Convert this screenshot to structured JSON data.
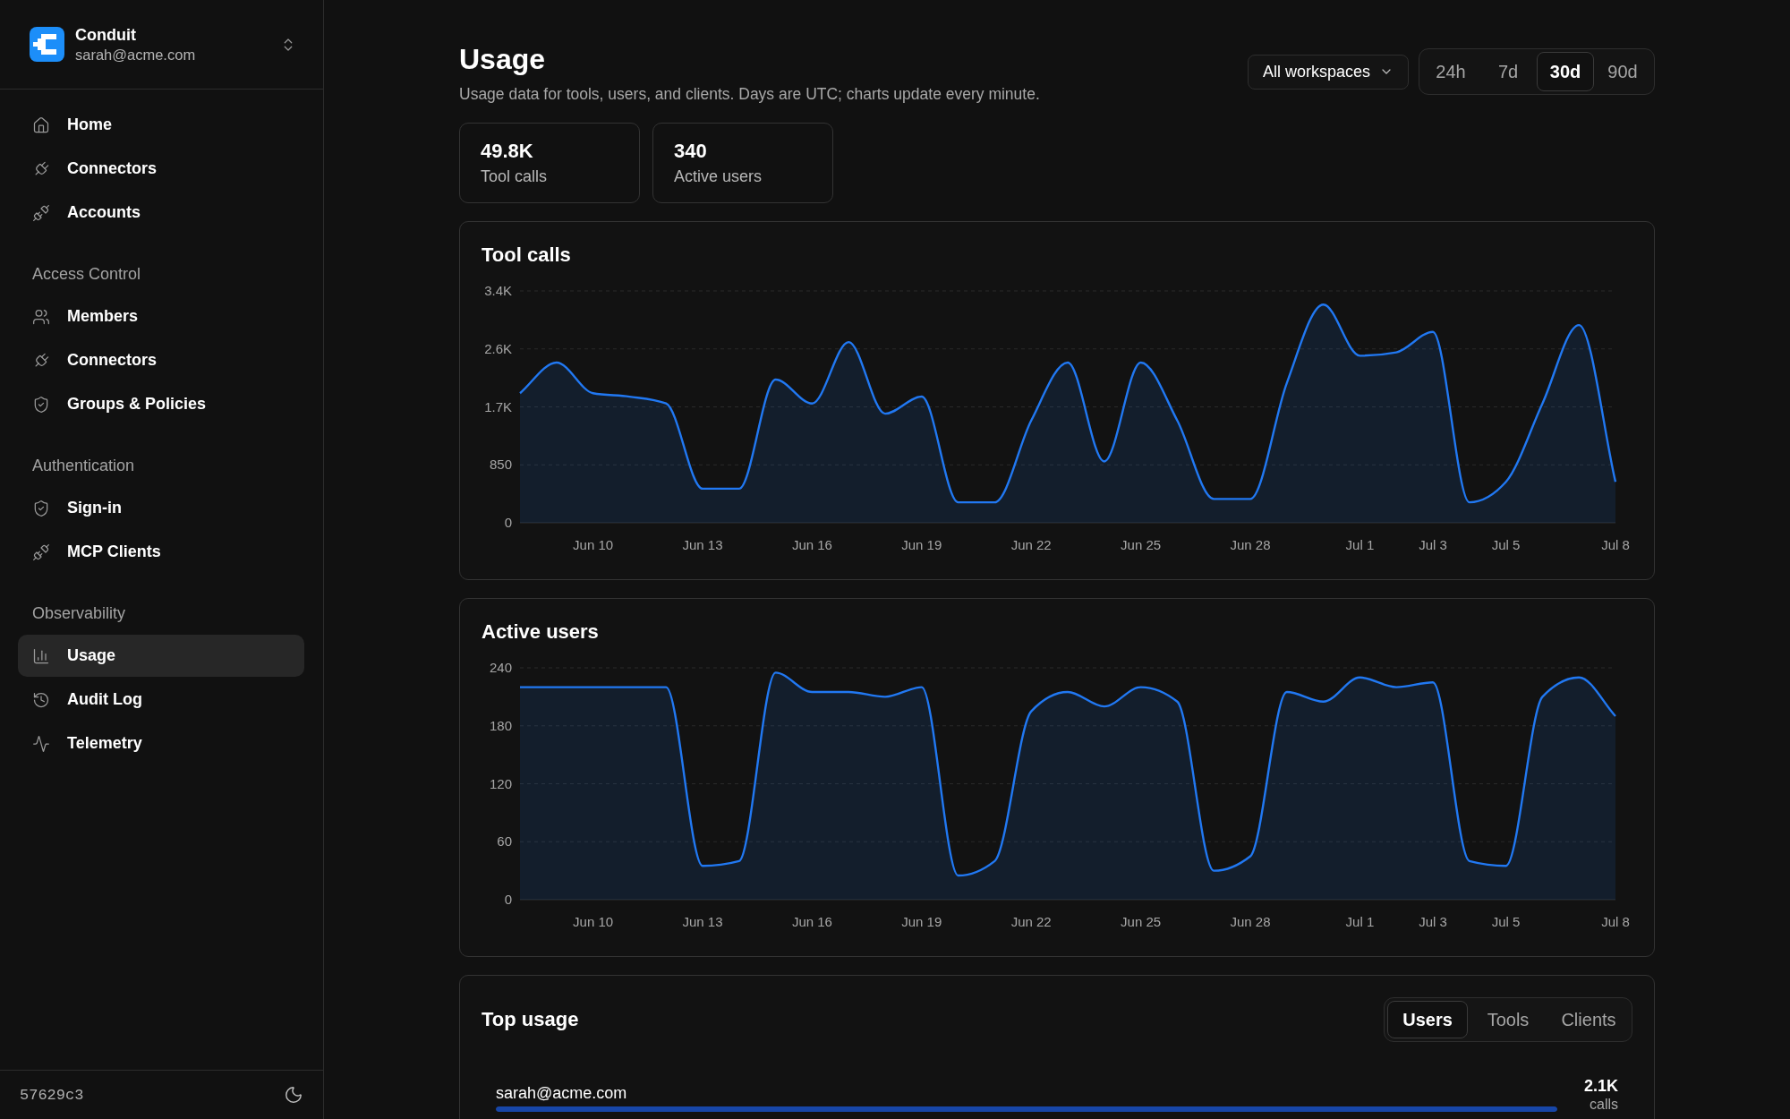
{
  "sidebar": {
    "brand": {
      "name": "Conduit",
      "email": "sarah@acme.com"
    },
    "sections": [
      {
        "items": [
          {
            "label": "Home",
            "selected": false
          },
          {
            "label": "Connectors",
            "selected": false
          },
          {
            "label": "Accounts",
            "selected": false
          }
        ]
      },
      {
        "title": "Access Control",
        "items": [
          {
            "label": "Members",
            "selected": false
          },
          {
            "label": "Connectors",
            "selected": false
          },
          {
            "label": "Groups & Policies",
            "selected": false
          }
        ]
      },
      {
        "title": "Authentication",
        "items": [
          {
            "label": "Sign-in",
            "selected": false
          },
          {
            "label": "MCP Clients",
            "selected": false
          }
        ]
      },
      {
        "title": "Observability",
        "items": [
          {
            "label": "Usage",
            "selected": true
          },
          {
            "label": "Audit Log",
            "selected": false
          },
          {
            "label": "Telemetry",
            "selected": false
          }
        ]
      }
    ],
    "footer": {
      "version": "57629c3"
    }
  },
  "header": {
    "title": "Usage",
    "subtitle": "Usage data for tools, users, and clients. Days are UTC; charts update every minute.",
    "workspace_select": {
      "value": "All workspaces"
    },
    "ranges": [
      {
        "label": "24h",
        "selected": false
      },
      {
        "label": "7d",
        "selected": false
      },
      {
        "label": "30d",
        "selected": true
      },
      {
        "label": "90d",
        "selected": false
      }
    ]
  },
  "stats": [
    {
      "value": "49.8K",
      "label": "Tool calls"
    },
    {
      "value": "340",
      "label": "Active users"
    }
  ],
  "charts": [
    {
      "chart_data": {
        "type": "area",
        "title": "Tool calls",
        "grid": true,
        "categories": [
          null,
          null,
          "Jun 10",
          null,
          null,
          "Jun 13",
          null,
          null,
          "Jun 16",
          null,
          null,
          "Jun 19",
          null,
          null,
          "Jun 22",
          null,
          null,
          "Jun 25",
          null,
          null,
          "Jun 28",
          null,
          null,
          "Jul 1",
          null,
          "Jul 3",
          null,
          "Jul 5",
          null,
          null,
          "Jul 8"
        ],
        "ylim": [
          0,
          3400
        ],
        "yticks": [
          0,
          850,
          {
            "value": 1700,
            "label": "1.7K"
          },
          {
            "value": 2550,
            "label": "2.6K"
          },
          {
            "value": 3400,
            "label": "3.4K"
          }
        ],
        "series": [
          {
            "color": "#2178f2",
            "values": [
              1900,
              2350,
              1900,
              1850,
              1750,
              500,
              500,
              2100,
              1750,
              2650,
              1600,
              1850,
              300,
              300,
              1500,
              2350,
              900,
              2350,
              1500,
              350,
              350,
              2050,
              3200,
              2450,
              2500,
              2800,
              300,
              600,
              1750,
              2900,
              600
            ]
          }
        ]
      }
    },
    {
      "chart_data": {
        "type": "area",
        "title": "Active users",
        "grid": true,
        "categories": [
          null,
          null,
          "Jun 10",
          null,
          null,
          "Jun 13",
          null,
          null,
          "Jun 16",
          null,
          null,
          "Jun 19",
          null,
          null,
          "Jun 22",
          null,
          null,
          "Jun 25",
          null,
          null,
          "Jun 28",
          null,
          null,
          "Jul 1",
          null,
          "Jul 3",
          null,
          "Jul 5",
          null,
          null,
          "Jul 8"
        ],
        "ylim": [
          0,
          240
        ],
        "yticks": [
          0,
          60,
          120,
          180,
          240
        ],
        "series": [
          {
            "color": "#2178f2",
            "values": [
              220,
              220,
              220,
              220,
              220,
              35,
              40,
              235,
              215,
              215,
              210,
              220,
              25,
              40,
              195,
              215,
              200,
              220,
              205,
              30,
              45,
              215,
              205,
              230,
              220,
              225,
              40,
              35,
              210,
              230,
              190
            ]
          }
        ]
      }
    }
  ],
  "top_usage": {
    "title": "Top usage",
    "tabs": [
      {
        "label": "Users",
        "selected": true
      },
      {
        "label": "Tools",
        "selected": false
      },
      {
        "label": "Clients",
        "selected": false
      }
    ],
    "rows": [
      {
        "name": "sarah@acme.com",
        "value": "2.1K",
        "unit": "calls",
        "level": 1
      }
    ]
  }
}
